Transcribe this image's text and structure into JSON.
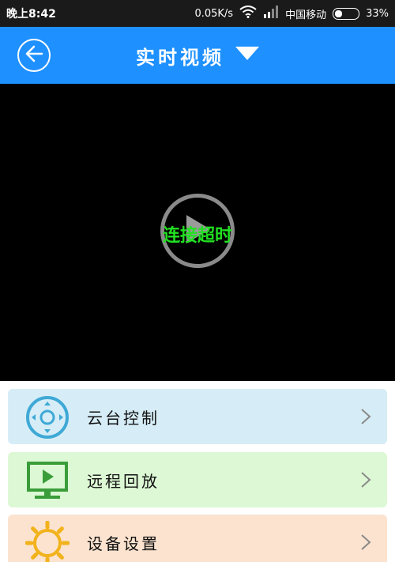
{
  "status_bar": {
    "time": "晚上8:42",
    "net_speed": "0.05K/s",
    "carrier": "中国移动",
    "battery_text": "33%",
    "battery_level": 0.33
  },
  "header": {
    "title": "实时视频",
    "background": "#1e90ff"
  },
  "video": {
    "status_text": "连接超时",
    "status_color": "#22e022"
  },
  "menu": {
    "items": [
      {
        "label": "云台控制",
        "icon": "ptz-joystick-icon",
        "bg": "#d6edf7",
        "icon_color": "#3fa9d6"
      },
      {
        "label": "远程回放",
        "icon": "monitor-play-icon",
        "bg": "#dcf8d4",
        "icon_color": "#3a9d3a"
      },
      {
        "label": "设备设置",
        "icon": "gear-sun-icon",
        "bg": "#fbe3cf",
        "icon_color": "#f2b21b"
      }
    ]
  }
}
